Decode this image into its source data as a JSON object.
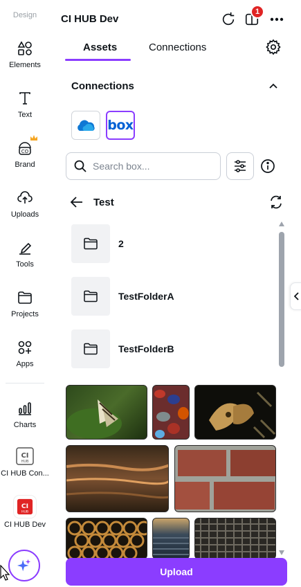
{
  "rail": {
    "top_label": "Design",
    "items": [
      {
        "label": "Elements",
        "icon": "elements-icon"
      },
      {
        "label": "Text",
        "icon": "text-icon"
      },
      {
        "label": "Brand",
        "icon": "brand-icon"
      },
      {
        "label": "Uploads",
        "icon": "upload-cloud-icon"
      },
      {
        "label": "Tools",
        "icon": "pen-icon"
      },
      {
        "label": "Projects",
        "icon": "folder-icon"
      },
      {
        "label": "Apps",
        "icon": "apps-icon"
      },
      {
        "label": "Charts",
        "icon": "chart-icon"
      },
      {
        "label": "CI HUB Con...",
        "icon": "ci-hub-icon"
      },
      {
        "label": "CI HUB Dev",
        "icon": "ci-hub-icon-red"
      }
    ],
    "ci_logo_text": "CI",
    "ci_logo_sub": "HUB"
  },
  "header": {
    "title": "CI HUB Dev",
    "badge_count": "1"
  },
  "tabs": [
    {
      "label": "Assets",
      "active": true
    },
    {
      "label": "Connections",
      "active": false
    }
  ],
  "connections": {
    "title": "Connections",
    "services": [
      {
        "name": "OneDrive",
        "icon": "onedrive-icon"
      },
      {
        "name": "box",
        "icon": "box-icon",
        "selected": true
      }
    ]
  },
  "search": {
    "placeholder": "Search box...",
    "value": ""
  },
  "breadcrumb": {
    "current": "Test"
  },
  "folders": [
    {
      "name": "2"
    },
    {
      "name": "TestFolderA"
    },
    {
      "name": "TestFolderB"
    }
  ],
  "images": [
    {
      "subject": "butterfly on leaf"
    },
    {
      "subject": "colorful pebbles"
    },
    {
      "subject": "moth on dark background"
    },
    {
      "subject": "sunset water"
    },
    {
      "subject": "brick wall"
    },
    {
      "subject": "honeycomb"
    },
    {
      "subject": "water reflection"
    },
    {
      "subject": "woven texture"
    }
  ],
  "upload_label": "Upload",
  "colors": {
    "accent": "#8b3dff",
    "badge": "#e02424",
    "box_blue": "#0061d5"
  }
}
